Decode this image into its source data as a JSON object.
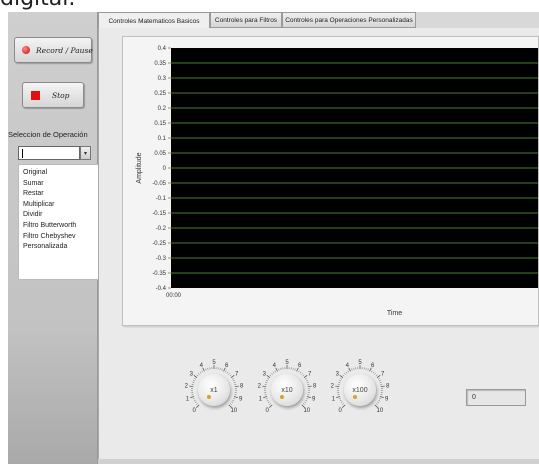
{
  "top_text": "digital.",
  "sidebar": {
    "record_label": "Record / Pause",
    "stop_label": "Stop",
    "selection_label": "Seleccion de Operación",
    "selection_value": "",
    "options": [
      "Original",
      "Sumar",
      "Restar",
      "Multiplicar",
      "Dividir",
      "Filtro Butterworth",
      "Filtro Chebyshev",
      "Personalizada"
    ]
  },
  "tabs": [
    {
      "label": "Controles Matematicos Basicos",
      "active": true
    },
    {
      "label": "Controles para Filtros",
      "active": false
    },
    {
      "label": "Controles para Operaciones Personalizadas",
      "active": false
    }
  ],
  "graph": {
    "ylabel": "Amplitude",
    "xlabel": "Time",
    "x_tick": "00:00",
    "y_ticks": [
      "0.4",
      "0.35",
      "0.3",
      "0.25",
      "0.2",
      "0.15",
      "0.1",
      "0.05",
      "0",
      "-0.05",
      "-0.1",
      "-0.15",
      "-0.2",
      "-0.25",
      "-0.3",
      "-0.35",
      "-0.4"
    ],
    "background": "#000000",
    "grid_color": "#5fa43a"
  },
  "knobs": [
    {
      "label": "x1",
      "value": 0
    },
    {
      "label": "x10",
      "value": 0
    },
    {
      "label": "x100",
      "value": 0
    }
  ],
  "dial_numbers": [
    "0",
    "1",
    "2",
    "3",
    "4",
    "5",
    "6",
    "7",
    "8",
    "9",
    "10"
  ],
  "numeric_value": "0",
  "colors": {
    "record_led": "#d40000",
    "stop_square": "#e01010",
    "knob_marker": "#e0a020"
  }
}
